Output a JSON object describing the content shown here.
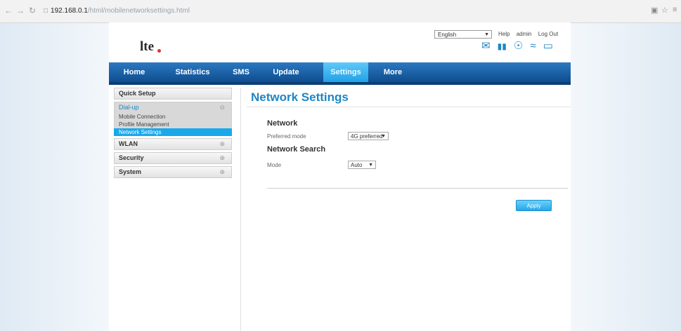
{
  "browser": {
    "back_icon": "arrow-left-icon",
    "forward_icon": "arrow-right-icon",
    "reload_icon": "reload-icon",
    "url_host": "192.168.0.1",
    "url_path": "/html/mobilenetworksettings.html"
  },
  "header": {
    "logo_text": "lte",
    "language": "English",
    "links": [
      "Help",
      "admin",
      "Log Out"
    ],
    "status_icons": [
      "message-icon",
      "signal-icon",
      "connection-icon",
      "wifi-icon",
      "battery-icon"
    ]
  },
  "nav": {
    "items": [
      {
        "label": "Home"
      },
      {
        "label": "Statistics"
      },
      {
        "label": "SMS"
      },
      {
        "label": "Update"
      },
      {
        "label": "Settings"
      },
      {
        "label": "More"
      }
    ],
    "active_index": 4,
    "accent": "#20a2e6"
  },
  "sidebar": {
    "quick_setup": "Quick Setup",
    "dialup": {
      "label": "Dial-up",
      "expand": "⊝"
    },
    "dialup_items": [
      "Mobile Connection",
      "Profile Management",
      "Network Settings"
    ],
    "wlan": {
      "label": "WLAN",
      "expand": "⊕"
    },
    "security": {
      "label": "Security",
      "expand": "⊕"
    },
    "system": {
      "label": "System",
      "expand": "⊕"
    }
  },
  "main": {
    "title": "Network Settings",
    "network_section": "Network",
    "preferred_mode_label": "Preferred mode",
    "preferred_mode_value": "4G preferred",
    "search_section": "Network Search",
    "mode_label": "Mode",
    "mode_value": "Auto",
    "apply_label": "Apply"
  }
}
